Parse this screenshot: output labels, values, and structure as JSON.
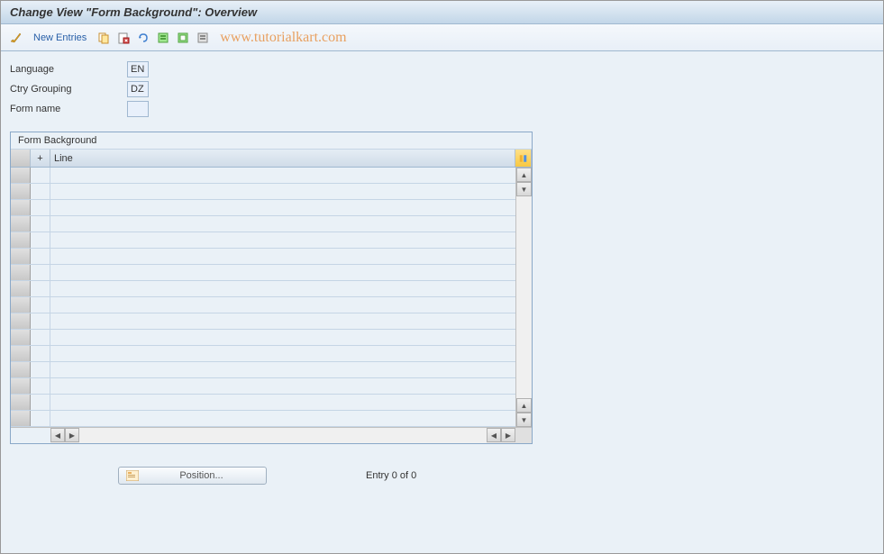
{
  "title": "Change View \"Form Background\": Overview",
  "toolbar": {
    "new_entries_label": "New Entries",
    "watermark": "www.tutorialkart.com"
  },
  "form": {
    "language_label": "Language",
    "language_value": "EN",
    "ctry_grouping_label": "Ctry Grouping",
    "ctry_grouping_value": "DZ",
    "form_name_label": "Form name",
    "form_name_value": ""
  },
  "table": {
    "title": "Form Background",
    "columns": {
      "plus": "+",
      "line": "Line"
    },
    "row_count": 16
  },
  "footer": {
    "position_label": "Position...",
    "entry_status": "Entry 0 of 0"
  }
}
